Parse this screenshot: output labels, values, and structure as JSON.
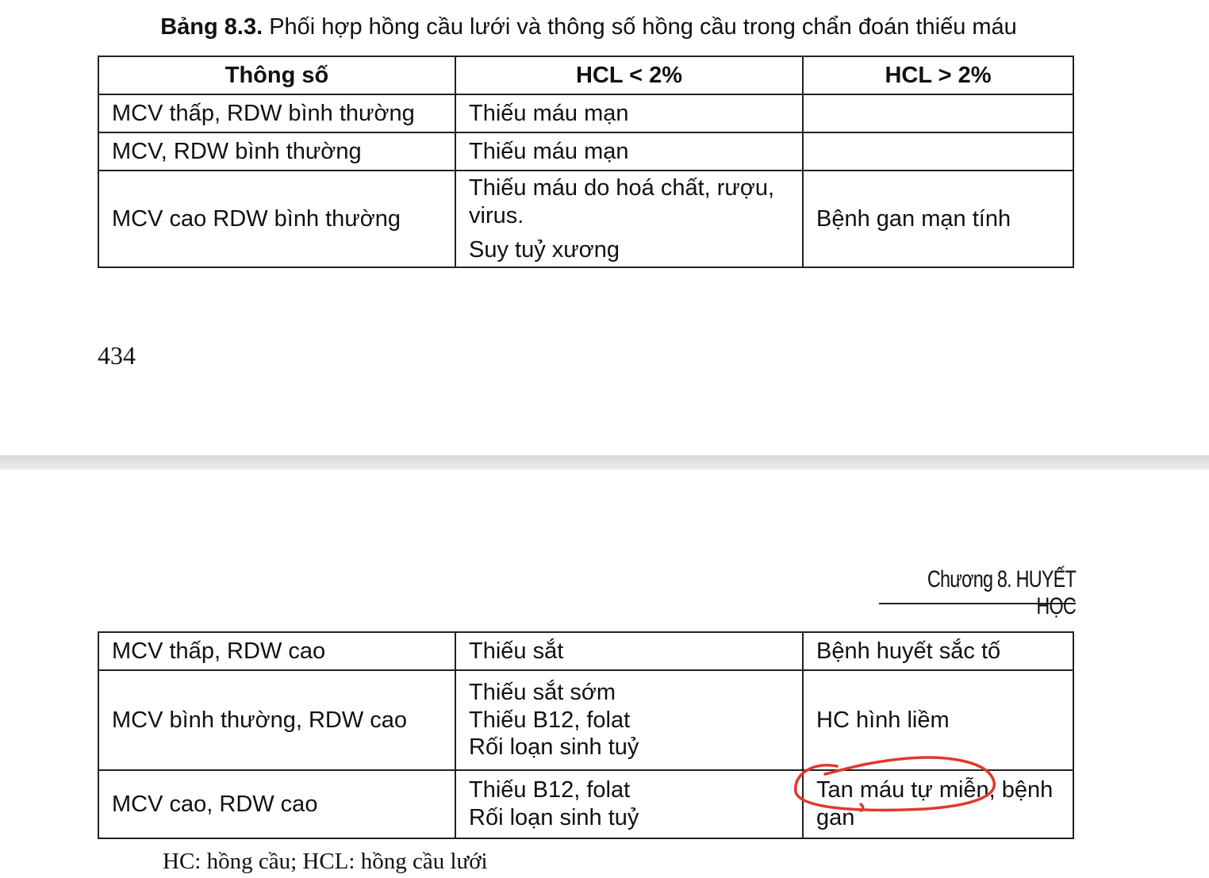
{
  "caption": {
    "label": "Bảng 8.3.",
    "text": " Phối hợp hồng cầu lưới và thông số hồng cầu trong chẩn đoán thiếu máu"
  },
  "table_top": {
    "headers": [
      "Thông số",
      "HCL < 2%",
      "HCL > 2%"
    ],
    "rows": [
      {
        "param": "MCV thấp, RDW bình thường",
        "low": [
          "Thiếu máu mạn"
        ],
        "high": ""
      },
      {
        "param": "MCV, RDW bình thường",
        "low": [
          "Thiếu máu mạn"
        ],
        "high": ""
      },
      {
        "param": "MCV cao RDW bình thường",
        "low": [
          "Thiếu máu do hoá chất, rượu,",
          "virus.",
          "Suy tuỷ xương"
        ],
        "high": "Bệnh gan mạn tính"
      }
    ]
  },
  "page_number": "434",
  "chapter_header": "Chương 8. HUYẾT HỌC",
  "table_bottom": {
    "rows": [
      {
        "param": "MCV thấp, RDW cao",
        "low": [
          "Thiếu sắt"
        ],
        "high": [
          "Bệnh huyết sắc tố"
        ]
      },
      {
        "param": "MCV bình thường, RDW cao",
        "low": [
          "Thiếu sắt sớm",
          "Thiếu B12, folat",
          "Rối loạn sinh tuỷ"
        ],
        "high": [
          "HC hình liềm"
        ]
      },
      {
        "param": "MCV cao, RDW cao",
        "low": [
          "Thiếu B12, folat",
          "Rối loạn sinh tuỷ"
        ],
        "high": [
          "Tan máu tự miễn, bệnh",
          "gan"
        ]
      }
    ]
  },
  "footnote": "HC: hồng cầu; HCL: hồng cầu lưới",
  "annotation_color": "#e0392e"
}
